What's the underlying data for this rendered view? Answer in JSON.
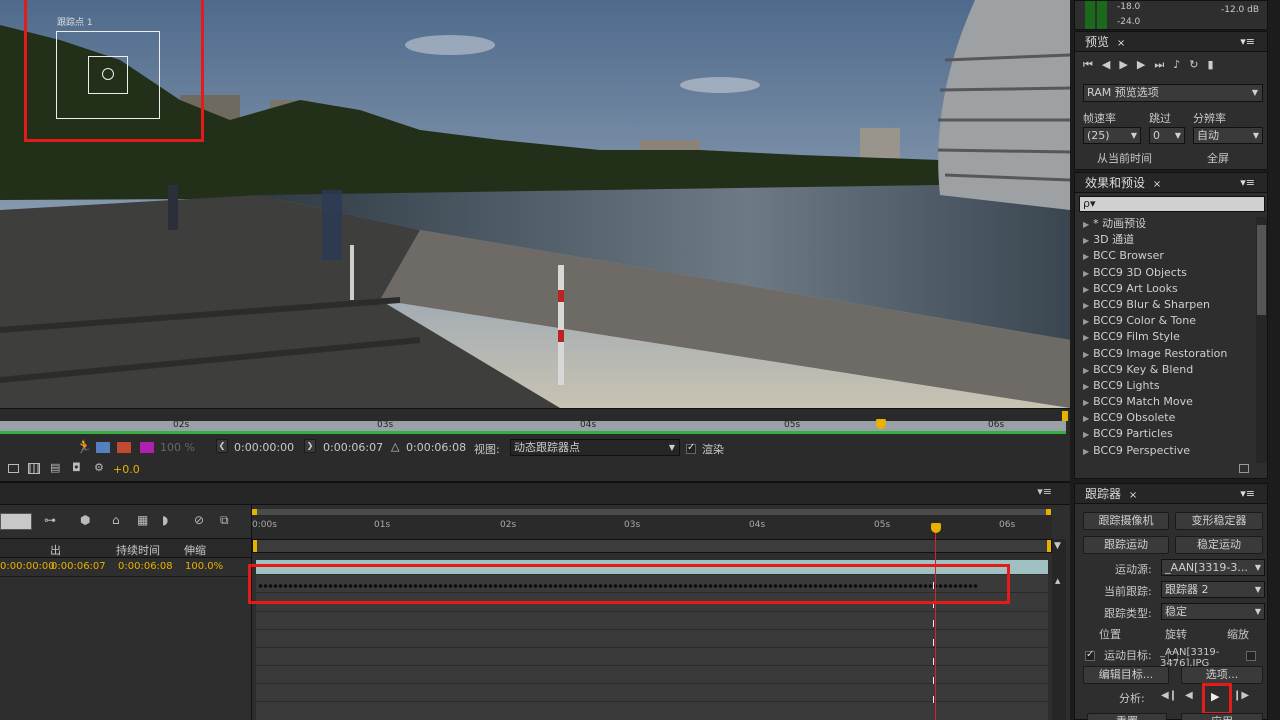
{
  "viewer": {
    "track_point_label": "跟踪点 1"
  },
  "ruler": {
    "ticks": [
      "02s",
      "03s",
      "04s",
      "05s",
      "06s"
    ]
  },
  "viewer_controls": {
    "zoom": "100 %",
    "in_time": "0:00:00:00",
    "out_time": "0:00:06:07",
    "duration": "0:00:06:08",
    "view_label": "视图:",
    "view_value": "动态跟踪器点",
    "render_label": "渲染",
    "exposure": "+0.0"
  },
  "timeline": {
    "ticks": [
      "0:00s",
      "01s",
      "02s",
      "03s",
      "04s",
      "05s",
      "06s"
    ],
    "col_out": "出",
    "col_duration": "持续时间",
    "col_stretch": "伸缩",
    "row_in": "0:00:00:00",
    "row_out": "0:00:06:07",
    "row_duration": "0:00:06:08",
    "row_stretch": "100.0%"
  },
  "audio": {
    "levels": [
      "-18.0",
      "-24.0"
    ],
    "db": "-12.0 dB"
  },
  "preview": {
    "tab": "预览",
    "ram_options": "RAM 预览选项",
    "frame_rate_label": "帧速率",
    "skip_label": "跳过",
    "resolution_label": "分辨率",
    "frame_rate_value": "(25)",
    "skip_value": "0",
    "resolution_value": "自动",
    "from_current": "从当前时间",
    "fullscreen": "全屏"
  },
  "effects": {
    "tab": "效果和预设",
    "search_placeholder": "ρ▾",
    "items": [
      "* 动画预设",
      "3D 通道",
      "BCC Browser",
      "BCC9 3D Objects",
      "BCC9 Art Looks",
      "BCC9 Blur & Sharpen",
      "BCC9 Color & Tone",
      "BCC9 Film Style",
      "BCC9 Image Restoration",
      "BCC9 Key & Blend",
      "BCC9 Lights",
      "BCC9 Match Move",
      "BCC9 Obsolete",
      "BCC9 Particles",
      "BCC9 Perspective"
    ]
  },
  "tracker": {
    "tab": "跟踪器",
    "track_camera": "跟踪摄像机",
    "warp_stabilizer": "变形稳定器",
    "track_motion": "跟踪运动",
    "stabilize_motion": "稳定运动",
    "motion_source_label": "运动源:",
    "motion_source_value": "_AAN[3319-3...",
    "current_track_label": "当前跟踪:",
    "current_track_value": "跟踪器 2",
    "track_type_label": "跟踪类型:",
    "track_type_value": "稳定",
    "position": "位置",
    "rotation": "旋转",
    "scale": "缩放",
    "motion_target_label": "运动目标:",
    "motion_target_value": "_AAN[3319-3476].JPG",
    "edit_target": "编辑目标...",
    "options": "选项...",
    "analyze_label": "分析:",
    "reset": "重置",
    "apply": "应用"
  }
}
